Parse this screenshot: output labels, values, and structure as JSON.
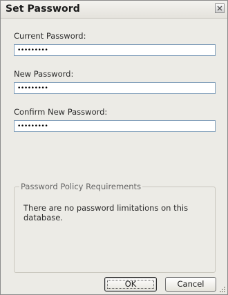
{
  "dialog": {
    "title": "Set Password",
    "close_icon": "close-icon"
  },
  "fields": {
    "current_password": {
      "label": "Current Password:",
      "value": "•••••••••"
    },
    "new_password": {
      "label": "New Password:",
      "value": "•••••••••"
    },
    "confirm_password": {
      "label": "Confirm New Password:",
      "value": "•••••••••"
    }
  },
  "policy": {
    "group_label": "Password Policy Requirements",
    "message": "There are no password limitations on this database."
  },
  "buttons": {
    "ok_label": "OK",
    "cancel_label": "Cancel"
  },
  "colors": {
    "dialog_background": "#ecebe6",
    "input_border": "#7f9db9"
  }
}
